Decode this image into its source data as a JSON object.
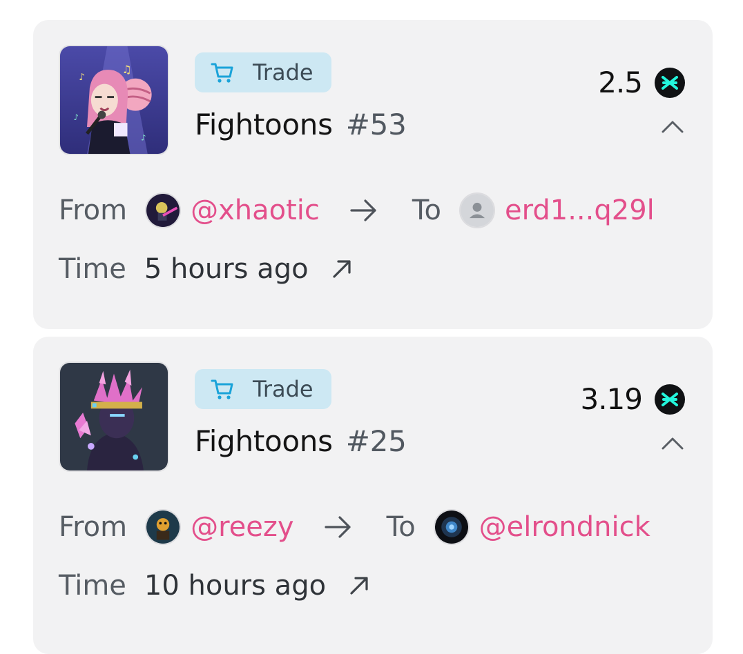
{
  "transactions": [
    {
      "type_label": "Trade",
      "collection": "Fightoons",
      "token_number": "#53",
      "price": "2.5",
      "token_icon": "egld-icon",
      "from_label": "From",
      "from_handle": "@xhaotic",
      "to_label": "To",
      "to_handle": "erd1...q29l",
      "time_label": "Time",
      "time_value": "5 hours ago"
    },
    {
      "type_label": "Trade",
      "collection": "Fightoons",
      "token_number": "#25",
      "price": "3.19",
      "token_icon": "egld-icon",
      "from_label": "From",
      "from_handle": "@reezy",
      "to_label": "To",
      "to_handle": "@elrondnick",
      "time_label": "Time",
      "time_value": "10 hours ago"
    }
  ],
  "colors": {
    "card_bg": "#f2f2f3",
    "badge_bg": "#cde8f3",
    "handle": "#e34f8b",
    "egld_mark": "#23f7dd"
  }
}
